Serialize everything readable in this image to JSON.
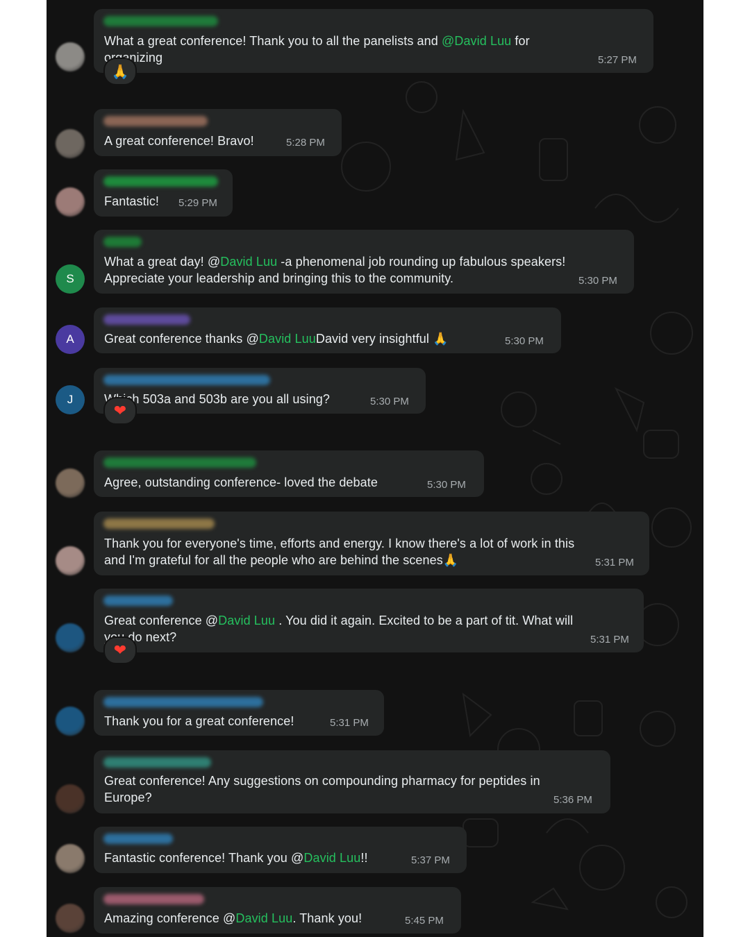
{
  "messages": [
    {
      "sender_color": "#1f7a3a",
      "avatar": {
        "type": "photo",
        "color": "#8c8a86"
      },
      "lines": [
        [
          {
            "t": "What a great conference! Thank you to all the panelists and "
          },
          {
            "t": "@David Luu",
            "m": true
          },
          {
            "t": " for"
          }
        ],
        [
          {
            "t": "organizing"
          }
        ]
      ],
      "time": "5:27 PM",
      "reaction": "pray"
    },
    {
      "sender_color": "#8a6555",
      "avatar": {
        "type": "photo",
        "color": "#6e6760"
      },
      "lines": [
        [
          {
            "t": "A great conference! Bravo!"
          }
        ]
      ],
      "time": "5:28 PM"
    },
    {
      "sender_color": "#1e8a3c",
      "avatar": {
        "type": "photo",
        "color": "#9c7b77"
      },
      "lines": [
        [
          {
            "t": "Fantastic!"
          }
        ]
      ],
      "time": "5:29 PM"
    },
    {
      "sender_color": "#1e7a36",
      "avatar": {
        "type": "letter",
        "letter": "S",
        "color": "#1f8a4c"
      },
      "lines": [
        [
          {
            "t": "What a great day! @"
          },
          {
            "t": "David Luu",
            "m": true
          },
          {
            "t": " -a phenomenal job rounding up fabulous speakers!"
          }
        ],
        [
          {
            "t": "Appreciate your leadership and bringing this to the community."
          }
        ]
      ],
      "time": "5:30 PM"
    },
    {
      "sender_color": "#5d4a9a",
      "avatar": {
        "type": "letter",
        "letter": "A",
        "color": "#4a3aa0"
      },
      "lines": [
        [
          {
            "t": "Great conference thanks @"
          },
          {
            "t": "David Luu",
            "m": true
          },
          {
            "t": "David very insightful "
          },
          {
            "pray": true
          }
        ]
      ],
      "time": "5:30 PM"
    },
    {
      "sender_color": "#2d6f9c",
      "avatar": {
        "type": "letter",
        "letter": "J",
        "color": "#1b5a85"
      },
      "lines": [
        [
          {
            "t": "Which 503a and 503b are you all using?"
          }
        ]
      ],
      "time": "5:30 PM",
      "reaction": "heart"
    },
    {
      "sender_color": "#1f7a3a",
      "avatar": {
        "type": "photo",
        "color": "#7c6a5a"
      },
      "lines": [
        [
          {
            "t": "Agree, outstanding conference- loved the debate"
          }
        ]
      ],
      "time": "5:30 PM"
    },
    {
      "sender_color": "#8d7646",
      "avatar": {
        "type": "photo",
        "color": "#a68b86"
      },
      "lines": [
        [
          {
            "t": "Thank you for everyone's time, efforts and energy. I know there's a lot of work in this"
          }
        ],
        [
          {
            "t": "and I'm grateful for all the people who are behind the scenes"
          },
          {
            "pray": true
          }
        ]
      ],
      "time": "5:31 PM"
    },
    {
      "sender_color": "#2d6f9c",
      "avatar": {
        "type": "photo",
        "color": "#1d5680"
      },
      "lines": [
        [
          {
            "t": "Great conference @"
          },
          {
            "t": "David Luu",
            "m": true
          },
          {
            "t": " . You did it again. Excited to be a part of tit. What will"
          }
        ],
        [
          {
            "t": "you do next?"
          }
        ]
      ],
      "time": "5:31 PM",
      "reaction": "heart"
    },
    {
      "sender_color": "#2d6f9c",
      "avatar": {
        "type": "photo",
        "color": "#1b5680"
      },
      "lines": [
        [
          {
            "t": "Thank you for a great conference!"
          }
        ]
      ],
      "time": "5:31 PM"
    },
    {
      "sender_color": "#2f7f72",
      "avatar": {
        "type": "photo",
        "color": "#4a3228"
      },
      "lines": [
        [
          {
            "t": "Great conference! Any suggestions on compounding pharmacy for peptides in"
          }
        ],
        [
          {
            "t": "Europe?"
          }
        ]
      ],
      "time": "5:36 PM"
    },
    {
      "sender_color": "#2d6f9c",
      "avatar": {
        "type": "photo",
        "color": "#8a7a6c"
      },
      "lines": [
        [
          {
            "t": "Fantastic conference! Thank you @"
          },
          {
            "t": "David Luu",
            "m": true
          },
          {
            "t": "!!"
          }
        ]
      ],
      "time": "5:37 PM"
    },
    {
      "sender_color": "#9a5a6c",
      "avatar": {
        "type": "photo",
        "color": "#5a4238"
      },
      "lines": [
        [
          {
            "t": "Amazing conference @"
          },
          {
            "t": "David Luu",
            "m": true
          },
          {
            "t": ". Thank you!"
          }
        ]
      ],
      "time": "5:45 PM"
    }
  ]
}
